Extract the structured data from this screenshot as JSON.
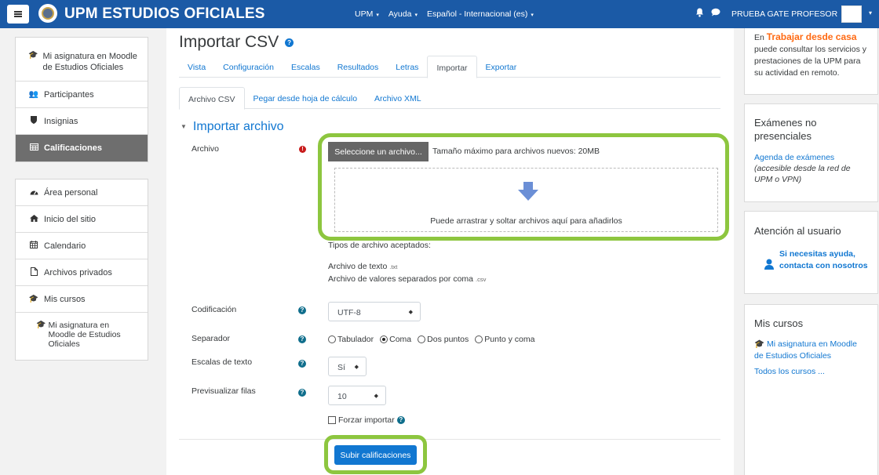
{
  "header": {
    "brand": "UPM ESTUDIOS OFICIALES",
    "menu": [
      {
        "label": "UPM",
        "caret": "▾"
      },
      {
        "label": "Ayuda",
        "caret": "▾"
      },
      {
        "label": "Español - Internacional (es)",
        "caret": "▾"
      }
    ],
    "user_name": "PRUEBA GATE PROFESOR"
  },
  "sidebar": {
    "course_nav": [
      {
        "label": "Mi asignatura en Moodle de Estudios Oficiales",
        "icon": "graduation-cap-icon"
      },
      {
        "label": "Participantes",
        "icon": "users-icon"
      },
      {
        "label": "Insignias",
        "icon": "shield-icon"
      },
      {
        "label": "Calificaciones",
        "icon": "table-icon",
        "active": true
      }
    ],
    "site_nav": [
      {
        "label": "Área personal",
        "icon": "dashboard-icon"
      },
      {
        "label": "Inicio del sitio",
        "icon": "home-icon"
      },
      {
        "label": "Calendario",
        "icon": "calendar-icon"
      },
      {
        "label": "Archivos privados",
        "icon": "file-icon"
      },
      {
        "label": "Mis cursos",
        "icon": "graduation-cap-icon"
      }
    ],
    "my_course": "Mi asignatura en Moodle de Estudios Oficiales"
  },
  "main": {
    "title": "Importar CSV",
    "tabs": [
      "Vista",
      "Configuración",
      "Escalas",
      "Resultados",
      "Letras",
      "Importar",
      "Exportar"
    ],
    "active_tab": "Importar",
    "subtabs": [
      "Archivo CSV",
      "Pegar desde hoja de cálculo",
      "Archivo XML"
    ],
    "active_subtab": "Archivo CSV",
    "section_title": "Importar archivo",
    "file": {
      "label": "Archivo",
      "button": "Seleccione un archivo...",
      "max_size": "Tamaño máximo para archivos nuevos: 20MB",
      "drop_text": "Puede arrastrar y soltar archivos aquí para añadirlos",
      "types_title": "Tipos de archivo aceptados:",
      "types": [
        {
          "name": "Archivo de texto",
          "ext": ".txt"
        },
        {
          "name": "Archivo de valores separados por coma",
          "ext": ".csv"
        }
      ]
    },
    "encoding": {
      "label": "Codificación",
      "value": "UTF-8"
    },
    "separator": {
      "label": "Separador",
      "options": [
        "Tabulador",
        "Coma",
        "Dos puntos",
        "Punto y coma"
      ],
      "selected": "Coma"
    },
    "text_scales": {
      "label": "Escalas de texto",
      "value": "Sí"
    },
    "preview_rows": {
      "label": "Previsualizar filas",
      "value": "10"
    },
    "force_import": {
      "label": "Forzar importar",
      "checked": false
    },
    "submit": "Subir calificaciones",
    "highlight_color": "#8dc63f"
  },
  "right": {
    "remote": {
      "prefix": "En",
      "highlight": "Trabajar desde casa",
      "text": "puede consultar los servicios y prestaciones de la UPM para su actividad en remoto."
    },
    "exams": {
      "title": "Exámenes no presenciales",
      "link": "Agenda de exámenes",
      "note": "(accesible desde la red de UPM o VPN)"
    },
    "support": {
      "title": "Atención al usuario",
      "link": "Si necesitas ayuda, contacta con nosotros"
    },
    "courses": {
      "title": "Mis cursos",
      "course": "Mi asignatura en Moodle de Estudios Oficiales",
      "all": "Todos los cursos ..."
    }
  },
  "colors": {
    "navbar": "#1b5aa6",
    "link": "#1177d1",
    "accent_orange": "#ff6a13",
    "highlight": "#8dc63f"
  }
}
